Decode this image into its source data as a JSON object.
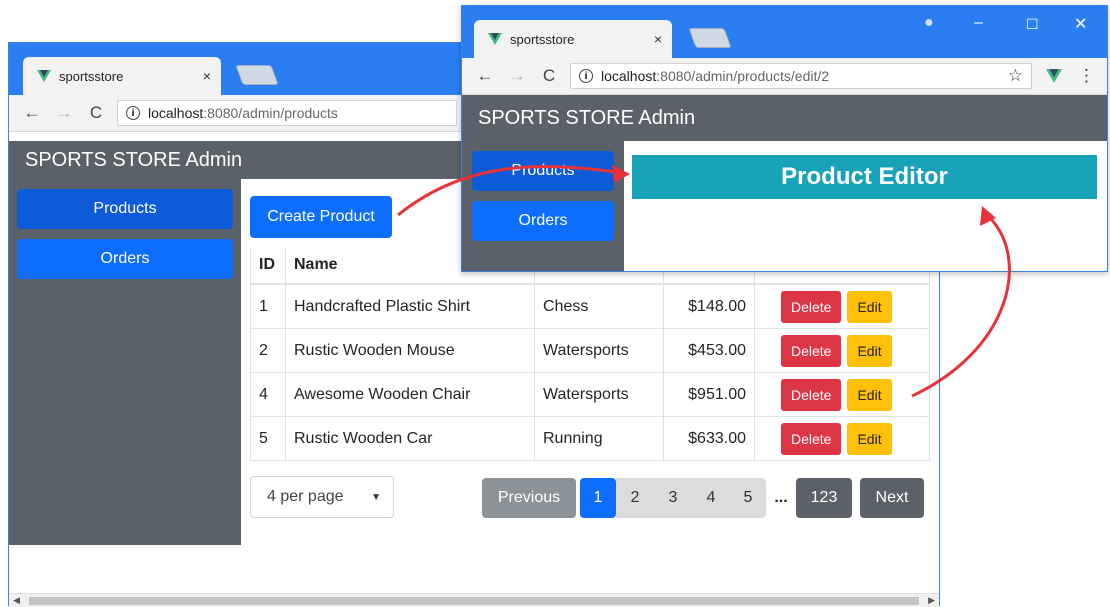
{
  "back_window": {
    "tab_title": "sportsstore",
    "tab_close": "×",
    "url_host": "localhost",
    "url_path": ":8080/admin/products",
    "nav": {
      "back": "←",
      "forward": "→",
      "reload": "C",
      "info": "i"
    },
    "app_title": "SPORTS STORE Admin",
    "sidebar": [
      {
        "label": "Products",
        "active": true
      },
      {
        "label": "Orders",
        "active": false
      }
    ],
    "create_button": "Create Product",
    "table": {
      "headers": [
        "ID",
        "Name",
        "",
        "",
        ""
      ],
      "rows": [
        {
          "id": "1",
          "name": "Handcrafted Plastic Shirt",
          "category": "Chess",
          "price": "$148.00"
        },
        {
          "id": "2",
          "name": "Rustic Wooden Mouse",
          "category": "Watersports",
          "price": "$453.00"
        },
        {
          "id": "4",
          "name": "Awesome Wooden Chair",
          "category": "Watersports",
          "price": "$951.00"
        },
        {
          "id": "5",
          "name": "Rustic Wooden Car",
          "category": "Running",
          "price": "$633.00"
        }
      ],
      "delete_label": "Delete",
      "edit_label": "Edit"
    },
    "page_size": "4 per page",
    "pagination": {
      "previous": "Previous",
      "pages": [
        "1",
        "2",
        "3",
        "4",
        "5"
      ],
      "ellipsis": "...",
      "last": "123",
      "next": "Next",
      "current": "1"
    }
  },
  "front_window": {
    "tab_title": "sportsstore",
    "tab_close": "×",
    "url_host": "localhost",
    "url_path": ":8080/admin/products/edit/2",
    "nav": {
      "back": "←",
      "forward": "→",
      "reload": "C",
      "info": "i"
    },
    "star": "☆",
    "menu": "⋮",
    "controls": {
      "account": "●",
      "minimize": "–",
      "maximize": "☐",
      "close": "✕"
    },
    "app_title": "SPORTS STORE Admin",
    "sidebar": [
      {
        "label": "Products",
        "active": true
      },
      {
        "label": "Orders",
        "active": false
      }
    ],
    "editor_title": "Product Editor"
  },
  "colors": {
    "chrome_blue": "#2b7df2",
    "app_nav": "#5b6168",
    "primary": "#0d6efd",
    "danger": "#dc3545",
    "warning": "#ffc107",
    "info": "#17a2b8",
    "arrow": "#e8323a"
  }
}
